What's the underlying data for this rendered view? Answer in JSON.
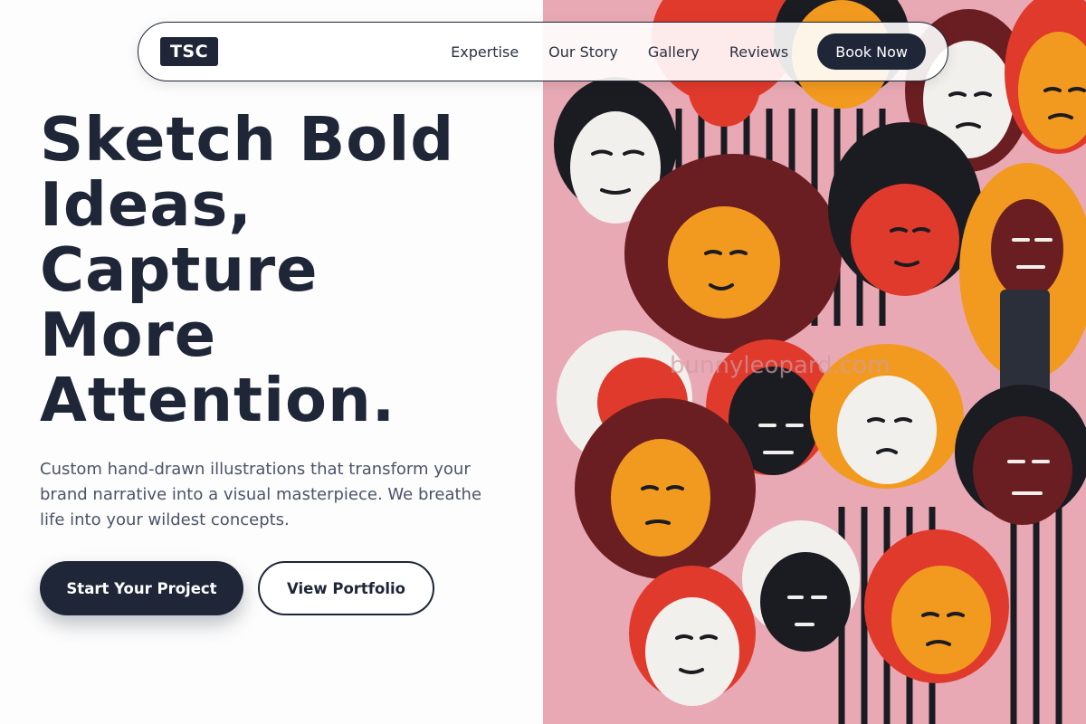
{
  "nav": {
    "logo": "TSC",
    "links": [
      "Expertise",
      "Our Story",
      "Gallery",
      "Reviews"
    ],
    "cta": "Book Now"
  },
  "hero": {
    "headline_lines": [
      "Sketch Bold",
      "Ideas,",
      "Capture",
      "More",
      "Attention."
    ],
    "subtext": "Custom hand-drawn illustrations that transform your brand narrative into a visual masterpiece. We breathe life into your wildest concepts.",
    "primary_cta": "Start Your Project",
    "secondary_cta": "View Portfolio",
    "image_watermark": "bunnyleopard.com"
  },
  "colors": {
    "primary": "#1e2638",
    "mural_pink": "#e8a9b4",
    "mural_orange": "#f29a1f",
    "mural_red": "#e03a2c",
    "mural_maroon": "#6b1e22"
  }
}
